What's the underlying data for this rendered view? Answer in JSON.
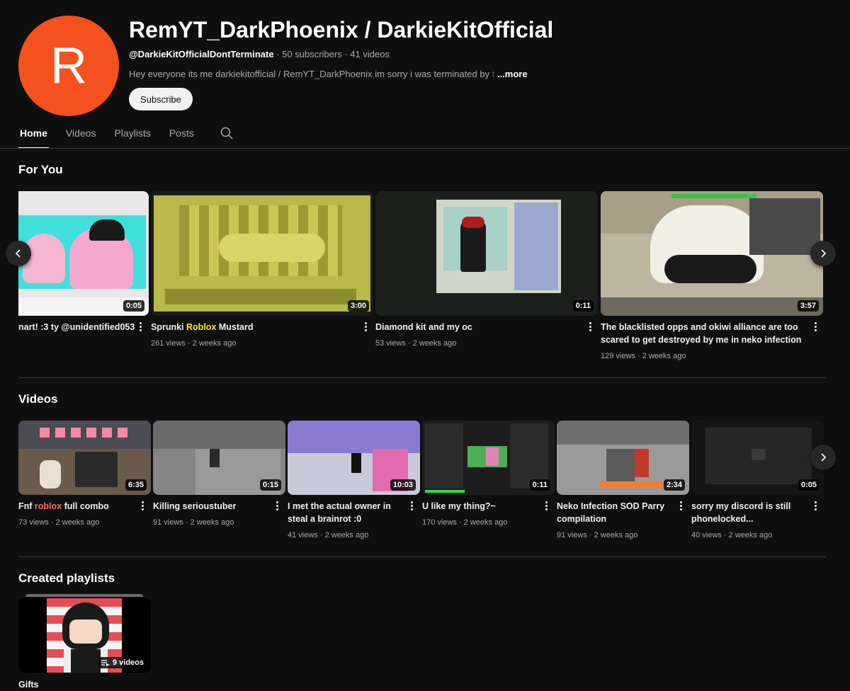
{
  "channel": {
    "avatar_letter": "R",
    "avatar_color": "#f4511e",
    "name": "RemYT_DarkPhoenix / DarkieKitOfficial",
    "handle": "@DarkieKitOfficialDontTerminate",
    "subscribers": "50 subscribers",
    "videos_count": "41 videos",
    "description": "Hey everyone its me darkiekitofficial / RemYT_DarkPhoenix im sorry i was terminated by",
    "description_fade": " t",
    "more_label": "...more",
    "subscribe_label": "Subscribe"
  },
  "tabs": [
    {
      "label": "Home",
      "active": true
    },
    {
      "label": "Videos"
    },
    {
      "label": "Playlists"
    },
    {
      "label": "Posts"
    }
  ],
  "for_you": {
    "title": "For You",
    "items": [
      {
        "title": "nart! :3 ty @unidentified053",
        "views": "",
        "duration": "0:05"
      },
      {
        "title_pre": "Sprunki ",
        "title_hl": "Roblox",
        "title_post": " Mustard",
        "views": "261 views · 2 weeks ago",
        "duration": "3:00"
      },
      {
        "title": "Diamond kit and my oc",
        "views": "53 views · 2 weeks ago",
        "duration": "0:11"
      },
      {
        "title": "The blacklisted opps and okiwi alliance are too scared to get destroyed by me in neko infection",
        "views": "129 views · 2 weeks ago",
        "duration": "3:57"
      }
    ]
  },
  "videos": {
    "title": "Videos",
    "items": [
      {
        "title_pre": "Fnf ",
        "title_hl": "roblox",
        "title_post": " full combo",
        "views": "73 views · 2 weeks ago",
        "duration": "6:35"
      },
      {
        "title": "Killing serioustuber",
        "views": "91 views · 2 weeks ago",
        "duration": "0:15"
      },
      {
        "title": "I met the actual owner in steal a brainrot :0",
        "views": "41 views · 2 weeks ago",
        "duration": "10:03"
      },
      {
        "title": "U like my thing?~",
        "views": "170 views · 2 weeks ago",
        "duration": "0:11"
      },
      {
        "title": "Neko Infection SOD Parry compilation",
        "views": "91 views · 2 weeks ago",
        "duration": "2:34"
      },
      {
        "title": "sorry my discord is still phonelocked...",
        "views": "40 views · 2 weeks ago",
        "duration": "0:05"
      }
    ]
  },
  "playlists": {
    "title": "Created playlists",
    "items": [
      {
        "title": "Gifts",
        "count": "9 videos"
      }
    ]
  }
}
